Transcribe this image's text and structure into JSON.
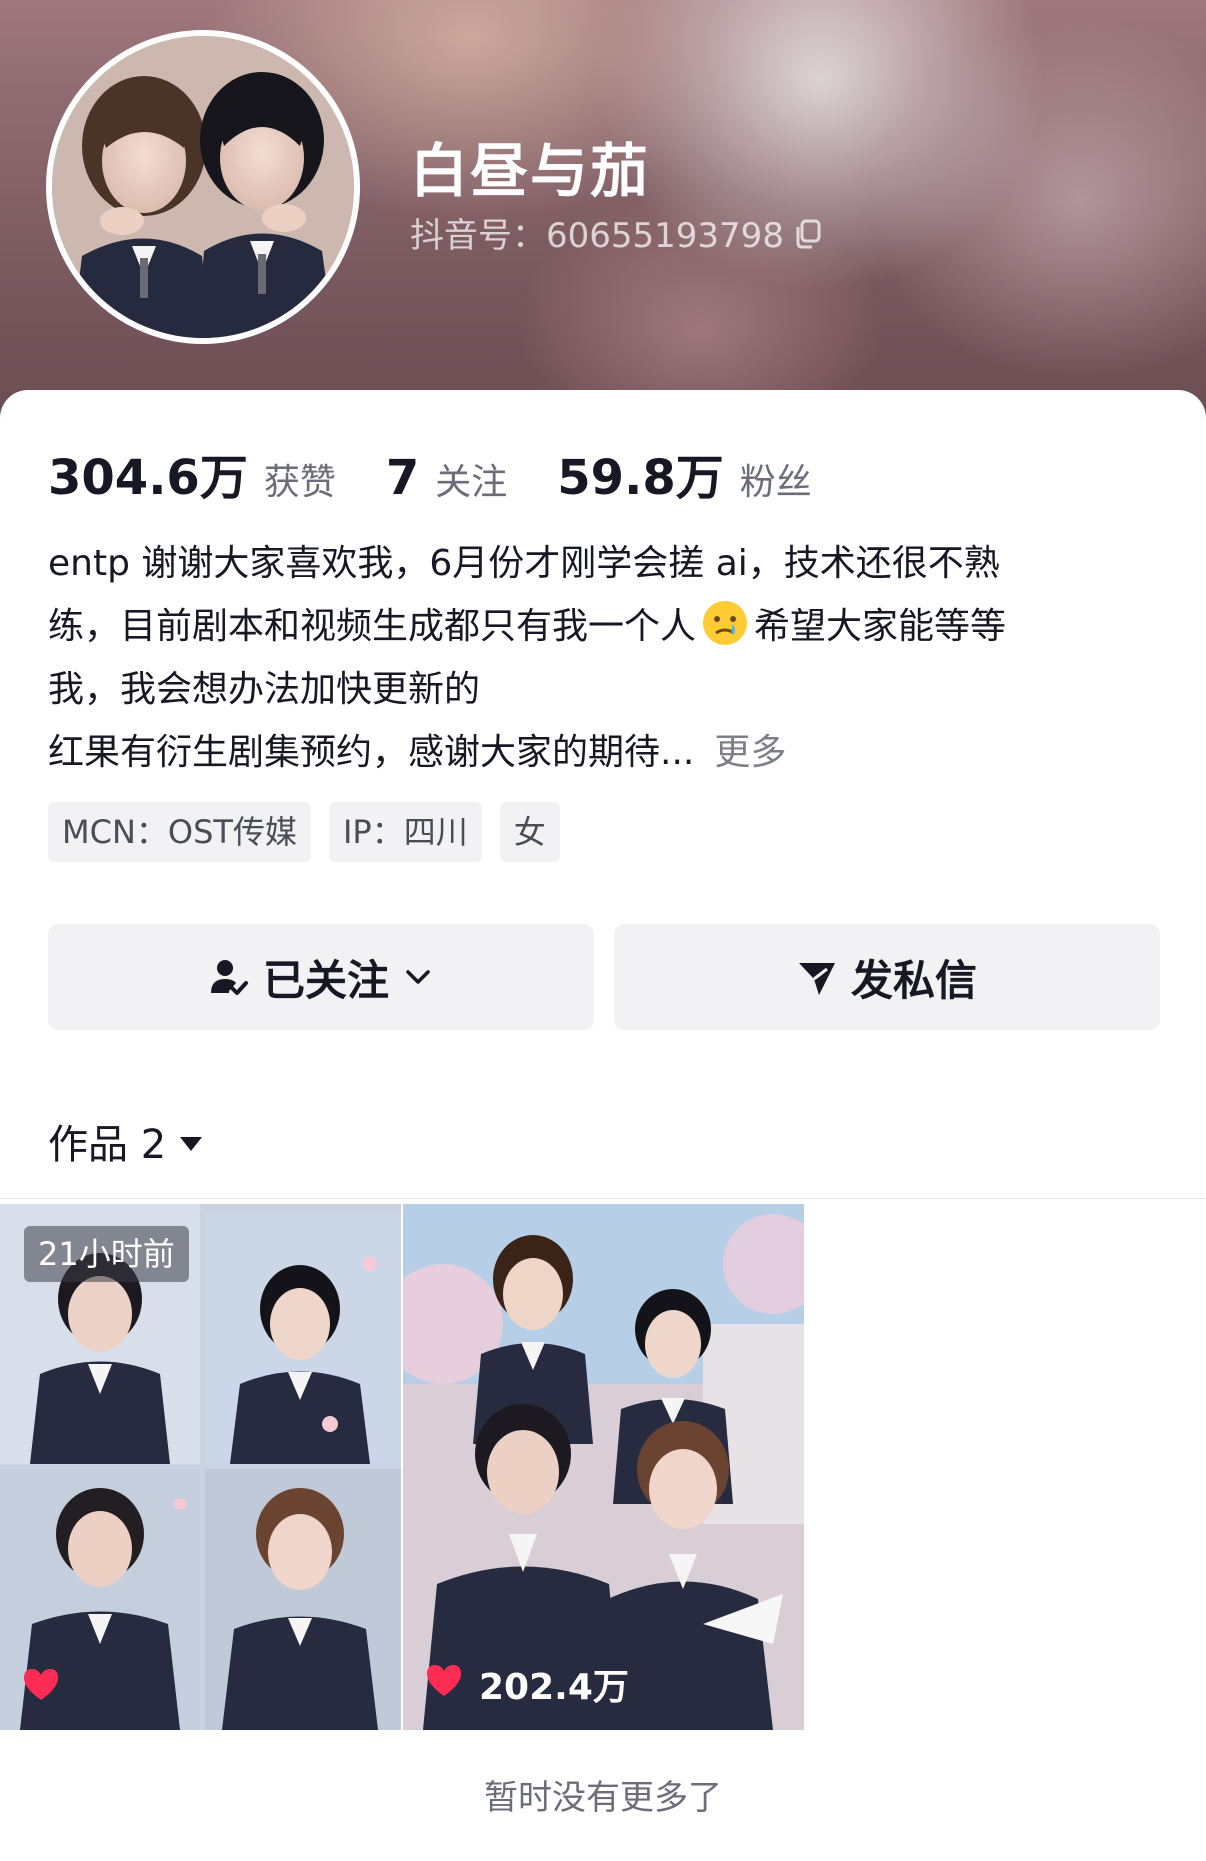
{
  "profile": {
    "nickname": "白昼与茄",
    "douyin_id": "抖音号：60655193798",
    "avatar_icon": "avatar-image"
  },
  "stats": [
    {
      "value": "304.6万",
      "label": "获赞"
    },
    {
      "value": "7",
      "label": "关注"
    },
    {
      "value": "59.8万",
      "label": "粉丝"
    }
  ],
  "bio": {
    "line1": "entp 谢谢大家喜欢我，6月份才刚学会搓 ai，技术还很不熟",
    "line2a": "练，目前剧本和视频生成都只有我一个人",
    "line2b": "希望大家能等等",
    "line3": "我，我会想办法加快更新的",
    "line4": "红果有衍生剧集预约，感谢大家的期待...",
    "more": "更多"
  },
  "tags": [
    "MCN：OST传媒",
    "IP：四川",
    "女"
  ],
  "actions": {
    "follow_label": "已关注",
    "message_label": "发私信"
  },
  "works": {
    "label": "作品 2",
    "items": [
      {
        "time": "21小时前",
        "likes": ""
      },
      {
        "time": "",
        "likes": "202.4万"
      }
    ]
  },
  "footer": {
    "no_more": "暂时没有更多了"
  },
  "colors": {
    "like": "#fe2c55",
    "text_primary": "#161823",
    "text_secondary": "#6b6d78",
    "button_bg": "#f2f2f4"
  }
}
